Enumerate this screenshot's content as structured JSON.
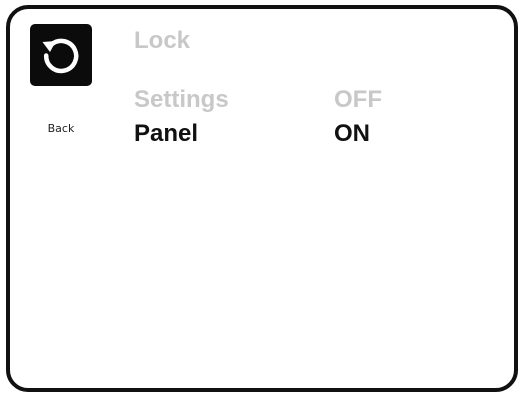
{
  "screen": {
    "title": "Lock",
    "back": {
      "label": "Back",
      "icon": "back-arrow-icon"
    },
    "items": [
      {
        "label": "Settings",
        "value": "OFF",
        "state": "inactive"
      },
      {
        "label": "Panel",
        "value": "ON",
        "state": "selected"
      }
    ]
  },
  "colors": {
    "frame": "#111111",
    "active_text": "#111111",
    "inactive_text": "#c8c8c8",
    "icon_background": "#0b0b0b"
  }
}
